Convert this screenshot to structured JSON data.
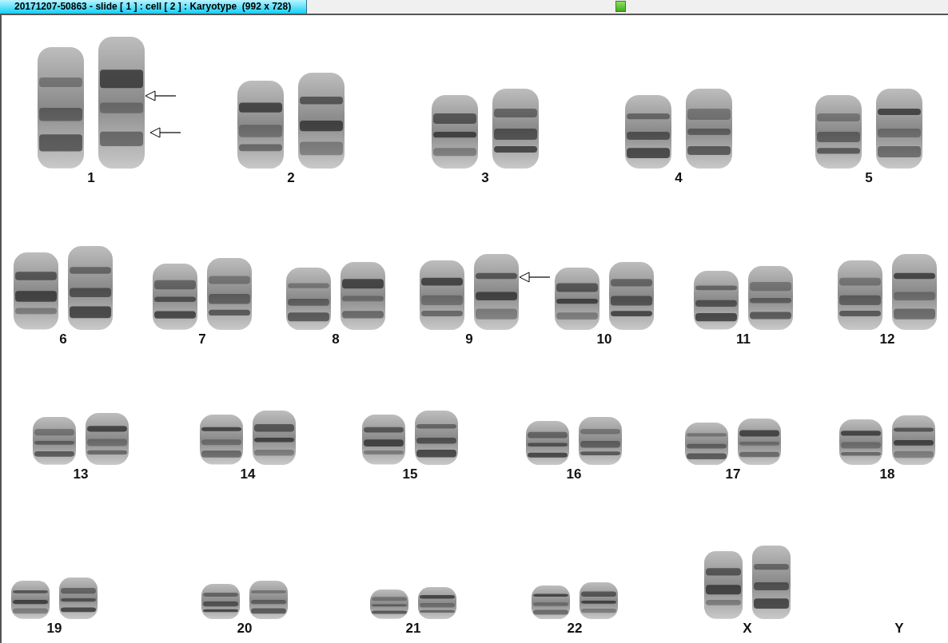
{
  "window": {
    "title": "20171207-50863 - slide [ 1 ] : cell [ 2 ] : Karyotype  (992 x 728)"
  },
  "rows": [
    {
      "pairs": [
        {
          "label": "1",
          "kind": "pair",
          "flagged": true
        },
        {
          "label": "2",
          "kind": "pair",
          "flagged": false
        },
        {
          "label": "3",
          "kind": "pair",
          "flagged": false
        },
        {
          "label": "4",
          "kind": "pair",
          "flagged": false
        },
        {
          "label": "5",
          "kind": "pair",
          "flagged": false
        }
      ]
    },
    {
      "pairs": [
        {
          "label": "6",
          "kind": "pair",
          "flagged": false
        },
        {
          "label": "7",
          "kind": "pair",
          "flagged": false
        },
        {
          "label": "8",
          "kind": "pair",
          "flagged": false
        },
        {
          "label": "9",
          "kind": "pair",
          "flagged": true
        },
        {
          "label": "10",
          "kind": "pair",
          "flagged": false
        },
        {
          "label": "11",
          "kind": "pair",
          "flagged": false
        },
        {
          "label": "12",
          "kind": "pair",
          "flagged": false
        }
      ]
    },
    {
      "pairs": [
        {
          "label": "13",
          "kind": "pair",
          "flagged": false
        },
        {
          "label": "14",
          "kind": "pair",
          "flagged": false
        },
        {
          "label": "15",
          "kind": "pair",
          "flagged": false
        },
        {
          "label": "16",
          "kind": "pair",
          "flagged": false
        },
        {
          "label": "17",
          "kind": "pair",
          "flagged": false
        },
        {
          "label": "18",
          "kind": "pair",
          "flagged": false
        }
      ]
    },
    {
      "pairs": [
        {
          "label": "19",
          "kind": "pair",
          "flagged": false
        },
        {
          "label": "20",
          "kind": "pair",
          "flagged": false
        },
        {
          "label": "21",
          "kind": "pair",
          "flagged": false
        },
        {
          "label": "22",
          "kind": "pair",
          "flagged": false
        },
        {
          "label": "X",
          "kind": "pair",
          "flagged": false
        },
        {
          "label": "Y",
          "kind": "empty",
          "flagged": false
        }
      ]
    }
  ]
}
